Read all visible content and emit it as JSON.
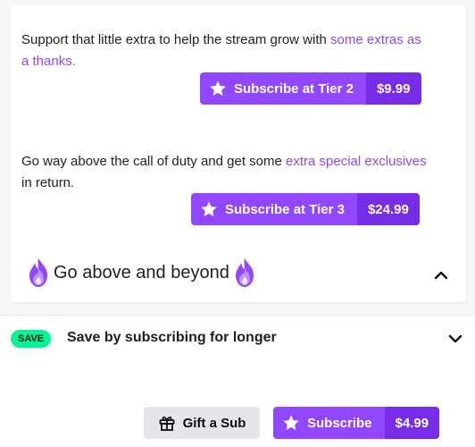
{
  "tier2": {
    "text_prefix": "Support that little extra to help the stream grow with ",
    "text_accent": "some extras as a thanks.",
    "button_label": "Subscribe at Tier 2",
    "price": "$9.99"
  },
  "tier3": {
    "text_prefix": "Go way above the call of duty and get some ",
    "text_accent": "extra special exclusives",
    "text_suffix": " in return.",
    "button_label": "Subscribe at Tier 3",
    "price": "$24.99"
  },
  "section": {
    "title": "Go above and beyond"
  },
  "save": {
    "badge": "SAVE",
    "label": "Save by subscribing for longer"
  },
  "footer": {
    "gift_label": "Gift a Sub",
    "subscribe_label": "Subscribe",
    "subscribe_price": "$4.99"
  },
  "icons": {
    "star": "star-icon",
    "flame": "purple-flame-icon",
    "gift": "gift-icon",
    "chevron_up": "chevron-up-icon",
    "chevron_down": "chevron-down-icon"
  },
  "colors": {
    "accent": "#9147ff",
    "accent_dark": "#772ce8",
    "save_badge": "#00f593"
  }
}
